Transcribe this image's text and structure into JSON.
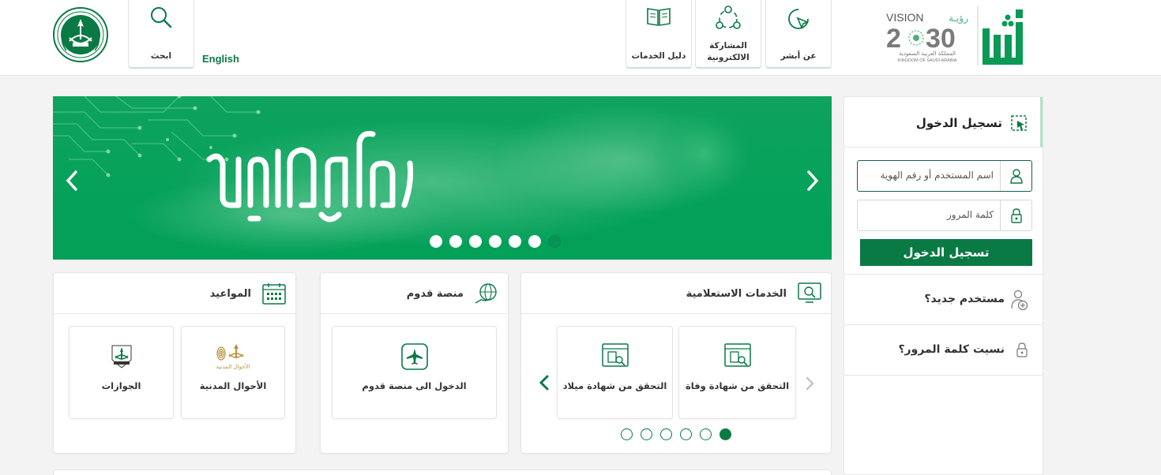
{
  "header": {
    "nav": [
      {
        "id": "about",
        "label": "عن أبشر",
        "icon": "cursor-circle-icon"
      },
      {
        "id": "eparticipation",
        "label": "المشاركة الالكترونية",
        "icon": "network-people-icon"
      },
      {
        "id": "services_guide",
        "label": "دليل الخدمات",
        "icon": "book-icon"
      }
    ],
    "search_label": "ابحث",
    "language_link": "English",
    "vision_text": "VISION",
    "vision_arabic": "رؤيـة",
    "vision_year_left": "2",
    "vision_year_right": "30",
    "vision_kingdom_ar": "المملكة العربية السعودية",
    "vision_kingdom_en": "KINGDOM OF SAUDI ARABIA",
    "absher_logo_text": "أبشر"
  },
  "banner": {
    "text": "رمضان مبارك",
    "slide_count": 7,
    "active_slide": 7
  },
  "login": {
    "title": "تسجيل الدخول",
    "username_placeholder": "اسم المستخدم أو رقم الهوية",
    "password_placeholder": "كلمة المرور",
    "submit_label": "تسجيل الدخول",
    "new_user": "مستخدم جديد؟",
    "forgot_password": "نسيت كلمة المرور؟"
  },
  "inquiry": {
    "title": "الخدمات الاستعلامية",
    "tiles": [
      {
        "label": "التحقق من شهادة وفاة"
      },
      {
        "label": "التحقق من شهادة ميلاد"
      }
    ],
    "page_count": 6,
    "active_page": 1
  },
  "qudoom": {
    "title": "منصة قدوم",
    "tiles": [
      {
        "label": "الدخول الى منصة قدوم"
      }
    ]
  },
  "appointments": {
    "title": "المواعيد",
    "tiles": [
      {
        "label": "الأحوال المدنية",
        "logo_text": "الأحوال المدنية"
      },
      {
        "label": "الجوازات"
      }
    ]
  },
  "colors": {
    "brand_green": "#0a7a45",
    "banner_green": "#05a15a",
    "light_border_green": "#c7e3d2"
  }
}
